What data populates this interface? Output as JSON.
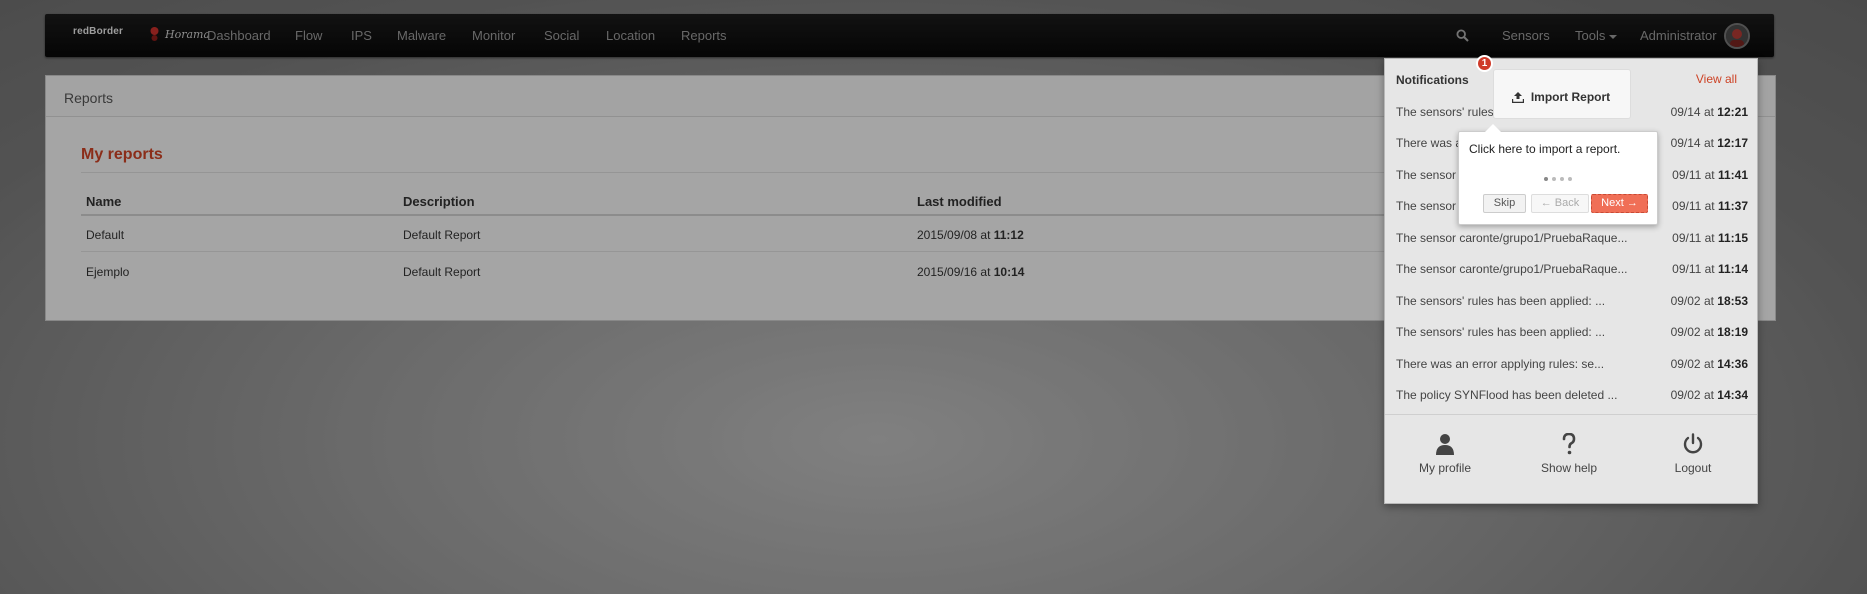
{
  "brand": {
    "name_1": "redBorder",
    "name_2": "Horama"
  },
  "nav": {
    "items": [
      "Dashboard",
      "Flow",
      "IPS",
      "Malware",
      "Monitor",
      "Social",
      "Location",
      "Reports"
    ],
    "sensors": "Sensors",
    "tools": "Tools",
    "user": "Administrator"
  },
  "panel": {
    "title": "Reports",
    "section_title": "My reports",
    "columns": [
      "Name",
      "Description",
      "Last modified"
    ],
    "rows": [
      {
        "name": "Default",
        "description": "Default Report",
        "date": "2015/09/08 at ",
        "time": "11:12"
      },
      {
        "name": "Ejemplo",
        "description": "Default Report",
        "date": "2015/09/16 at ",
        "time": "10:14"
      }
    ]
  },
  "notifications": {
    "title": "Notifications",
    "view_all": "View all",
    "items": [
      {
        "msg": "The sensors' rules has been applied: ...",
        "date": "09/14 at ",
        "time": "12:21"
      },
      {
        "msg": "There was an error applying rules: se...",
        "date": "09/14 at ",
        "time": "12:17"
      },
      {
        "msg": "The sensor caronte/grupo1/PruebaRaque...",
        "date": "09/11 at ",
        "time": "11:41"
      },
      {
        "msg": "The sensor caronte/grupo1/PruebaRaque...",
        "date": "09/11 at ",
        "time": "11:37"
      },
      {
        "msg": "The sensor caronte/grupo1/PruebaRaque...",
        "date": "09/11 at ",
        "time": "11:15"
      },
      {
        "msg": "The sensor caronte/grupo1/PruebaRaque...",
        "date": "09/11 at ",
        "time": "11:14"
      },
      {
        "msg": "The sensors' rules has been applied: ...",
        "date": "09/02 at ",
        "time": "18:53"
      },
      {
        "msg": "The sensors' rules has been applied: ...",
        "date": "09/02 at ",
        "time": "18:19"
      },
      {
        "msg": "There was an error applying rules: se...",
        "date": "09/02 at ",
        "time": "14:36"
      },
      {
        "msg": "The policy SYNFlood has been deleted ...",
        "date": "09/02 at ",
        "time": "14:34"
      }
    ],
    "footer": {
      "profile": "My profile",
      "help": "Show help",
      "logout": "Logout"
    }
  },
  "tour": {
    "step_badge": "1",
    "target_label": "Import Report",
    "text": "Click here to import a report.",
    "dots_total": 4,
    "dots_active": 1,
    "skip": "Skip",
    "back": "← Back",
    "next": "Next →"
  },
  "colors": {
    "accent": "#cd4326",
    "next_button": "#f06f57",
    "navbar": "#111111"
  }
}
